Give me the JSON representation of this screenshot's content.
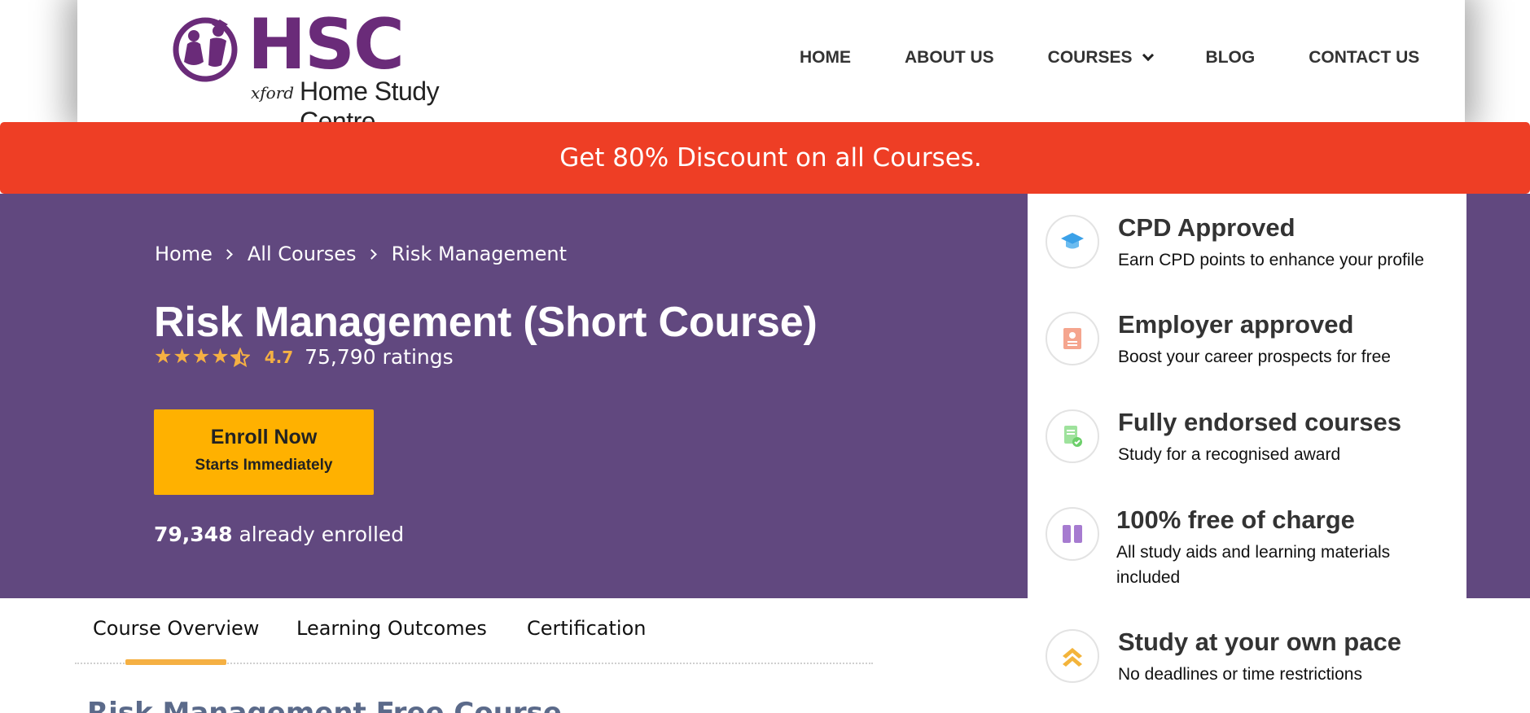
{
  "header": {
    "logo": {
      "mark_text": "HSC",
      "xford": "xford",
      "subtitle": "Home Study Centre"
    },
    "nav": [
      {
        "label": "HOME"
      },
      {
        "label": "ABOUT US"
      },
      {
        "label": "COURSES",
        "has_dropdown": true
      },
      {
        "label": "BLOG"
      },
      {
        "label": "CONTACT US"
      }
    ]
  },
  "banner": {
    "text": "Get 80% Discount on all Courses."
  },
  "hero": {
    "breadcrumb": [
      "Home",
      "All Courses",
      "Risk Management"
    ],
    "title": "Risk Management (Short Course)",
    "rating": {
      "stars": 4.5,
      "value": "4.7",
      "count": "75,790 ratings"
    },
    "enroll": {
      "label": "Enroll Now",
      "sublabel": "Starts Immediately"
    },
    "enrolled": {
      "count": "79,348",
      "text": "already enrolled"
    }
  },
  "features": [
    {
      "icon": "graduation-cap-icon",
      "color": "#3ba1e8",
      "title": "CPD Approved",
      "desc": "Earn CPD points to enhance your profile"
    },
    {
      "icon": "certificate-icon",
      "color": "#f08468",
      "title": "Employer approved",
      "desc": "Boost your career prospects for free"
    },
    {
      "icon": "document-check-icon",
      "color": "#6ccf6a",
      "title": "Fully endorsed courses",
      "desc": "Study for a recognised award"
    },
    {
      "icon": "book-icon",
      "color": "#a67bd0",
      "title": "100% free of charge",
      "desc": "All study aids and learning materials included"
    },
    {
      "icon": "double-chevron-up-icon",
      "color": "#f3b43b",
      "title": "Study at your own pace",
      "desc": "No deadlines or time restrictions"
    }
  ],
  "tabs": [
    {
      "label": "Course Overview",
      "active": true
    },
    {
      "label": "Learning Outcomes"
    },
    {
      "label": "Certification"
    }
  ],
  "section_heading": "Risk Management Free Course",
  "colors": {
    "brand_purple": "#6a2b79",
    "hero_bg": "#61487f",
    "banner_red": "#ee3e25",
    "accent_yellow": "#ffb100",
    "star": "#f5b043"
  }
}
